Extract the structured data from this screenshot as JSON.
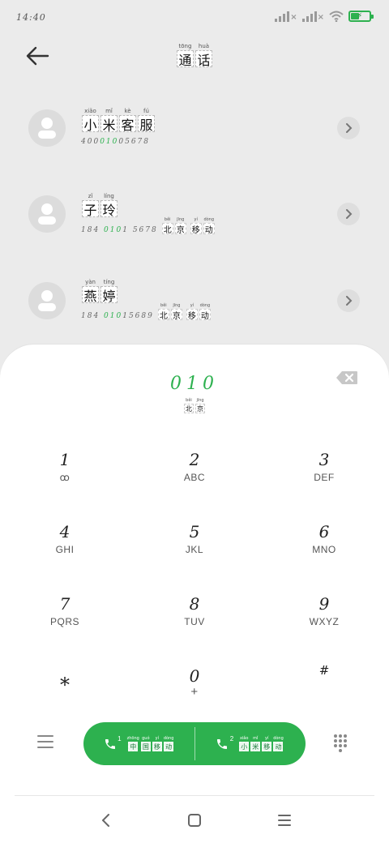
{
  "status_bar": {
    "time": "14:40",
    "icons": [
      "signal-icon",
      "signal-icon",
      "wifi-icon",
      "battery-charging-icon"
    ]
  },
  "header": {
    "back_icon": "arrow-left-icon",
    "title": [
      {
        "hanzi": "通",
        "pinyin": "tōng"
      },
      {
        "hanzi": "话",
        "pinyin": "huà"
      }
    ]
  },
  "contacts": [
    {
      "name": [
        {
          "hanzi": "小",
          "pinyin": "xiǎo"
        },
        {
          "hanzi": "米",
          "pinyin": "mǐ"
        },
        {
          "hanzi": "客",
          "pinyin": "kè"
        },
        {
          "hanzi": "服",
          "pinyin": "fú"
        }
      ],
      "number_pre": "400",
      "number_match": "010",
      "number_post": "05678",
      "carrier": []
    },
    {
      "name": [
        {
          "hanzi": "子",
          "pinyin": "zǐ"
        },
        {
          "hanzi": "玲",
          "pinyin": "líng"
        }
      ],
      "number_pre": "184 ",
      "number_match": "010",
      "number_post": "1 5678",
      "carrier": [
        {
          "hanzi": "北",
          "pinyin": "běi"
        },
        {
          "hanzi": "京",
          "pinyin": "jīng"
        },
        {
          "hanzi": "移",
          "pinyin": "yí"
        },
        {
          "hanzi": "动",
          "pinyin": "dòng"
        }
      ]
    },
    {
      "name": [
        {
          "hanzi": "燕",
          "pinyin": "yàn"
        },
        {
          "hanzi": "婷",
          "pinyin": "tíng"
        }
      ],
      "number_pre": "184 ",
      "number_match": "010",
      "number_post": "15689",
      "carrier": [
        {
          "hanzi": "北",
          "pinyin": "běi"
        },
        {
          "hanzi": "京",
          "pinyin": "jīng"
        },
        {
          "hanzi": "移",
          "pinyin": "yí"
        },
        {
          "hanzi": "动",
          "pinyin": "dòng"
        }
      ]
    }
  ],
  "dialer": {
    "input": "010",
    "location": [
      {
        "hanzi": "北",
        "pinyin": "běi"
      },
      {
        "hanzi": "京",
        "pinyin": "jīng"
      }
    ],
    "keys": [
      {
        "num": "1",
        "sub": "ꝏ"
      },
      {
        "num": "2",
        "sub": "ABC"
      },
      {
        "num": "3",
        "sub": "DEF"
      },
      {
        "num": "4",
        "sub": "GHI"
      },
      {
        "num": "5",
        "sub": "JKL"
      },
      {
        "num": "6",
        "sub": "MNO"
      },
      {
        "num": "7",
        "sub": "PQRS"
      },
      {
        "num": "8",
        "sub": "TUV"
      },
      {
        "num": "9",
        "sub": "WXYZ"
      },
      {
        "num": "*",
        "sub": ""
      },
      {
        "num": "0",
        "sub": "+"
      },
      {
        "num": "#",
        "sub": ""
      }
    ],
    "sim1": {
      "slot": "1",
      "carrier": [
        {
          "hanzi": "中",
          "pinyin": "zhōng"
        },
        {
          "hanzi": "国",
          "pinyin": "guó"
        },
        {
          "hanzi": "移",
          "pinyin": "yí"
        },
        {
          "hanzi": "动",
          "pinyin": "dòng"
        }
      ]
    },
    "sim2": {
      "slot": "2",
      "carrier": [
        {
          "hanzi": "小",
          "pinyin": "xiǎo"
        },
        {
          "hanzi": "米",
          "pinyin": "mǐ"
        },
        {
          "hanzi": "移",
          "pinyin": "yí"
        },
        {
          "hanzi": "动",
          "pinyin": "dòng"
        }
      ]
    },
    "colors": {
      "accent": "#2db14f"
    }
  },
  "nav": {
    "icons": [
      "back-nav-icon",
      "home-nav-icon",
      "recents-nav-icon"
    ]
  }
}
